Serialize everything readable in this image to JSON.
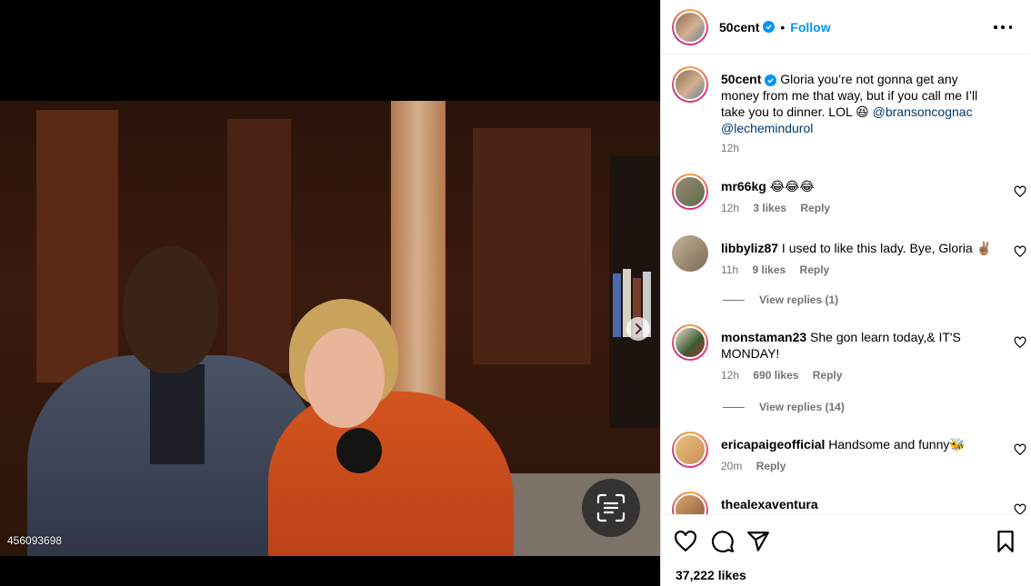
{
  "media": {
    "photo_id": "456093698"
  },
  "post": {
    "username": "50cent",
    "follow_label": "Follow",
    "dot": "•",
    "caption": {
      "text": "Gloria you’re not gonna get any money from me that way, but if you call me I’ll take you to dinner. LOL 😆",
      "mention1": "@bransoncognac",
      "mention2": "@lechemindurol",
      "time": "12h"
    }
  },
  "comments": [
    {
      "username": "mr66kg",
      "text": "😂😂😂",
      "time": "12h",
      "likes": "3 likes",
      "reply": "Reply"
    },
    {
      "username": "libbyliz87",
      "text": "I used to like this lady. Bye, Gloria ✌🏽",
      "time": "11h",
      "likes": "9 likes",
      "reply": "Reply",
      "view_replies": "View replies (1)"
    },
    {
      "username": "monstaman23",
      "text": "She gon learn today,& IT'S MONDAY!",
      "time": "12h",
      "likes": "690 likes",
      "reply": "Reply",
      "view_replies": "View replies (14)"
    },
    {
      "username": "ericapaigeofficial",
      "text": "Handsome and funny🐝",
      "time": "20m",
      "reply": "Reply"
    },
    {
      "username": "thealexaventura",
      "text": ""
    }
  ],
  "footer": {
    "likes": "37,222 likes"
  },
  "colors": {
    "accent": "#0095f6",
    "link": "#00376b",
    "muted": "#737373"
  },
  "icons": [
    "chevron-right-icon",
    "visual-search-icon",
    "verified-icon",
    "more-options-icon",
    "heart-icon",
    "comment-icon",
    "share-icon",
    "bookmark-icon"
  ]
}
